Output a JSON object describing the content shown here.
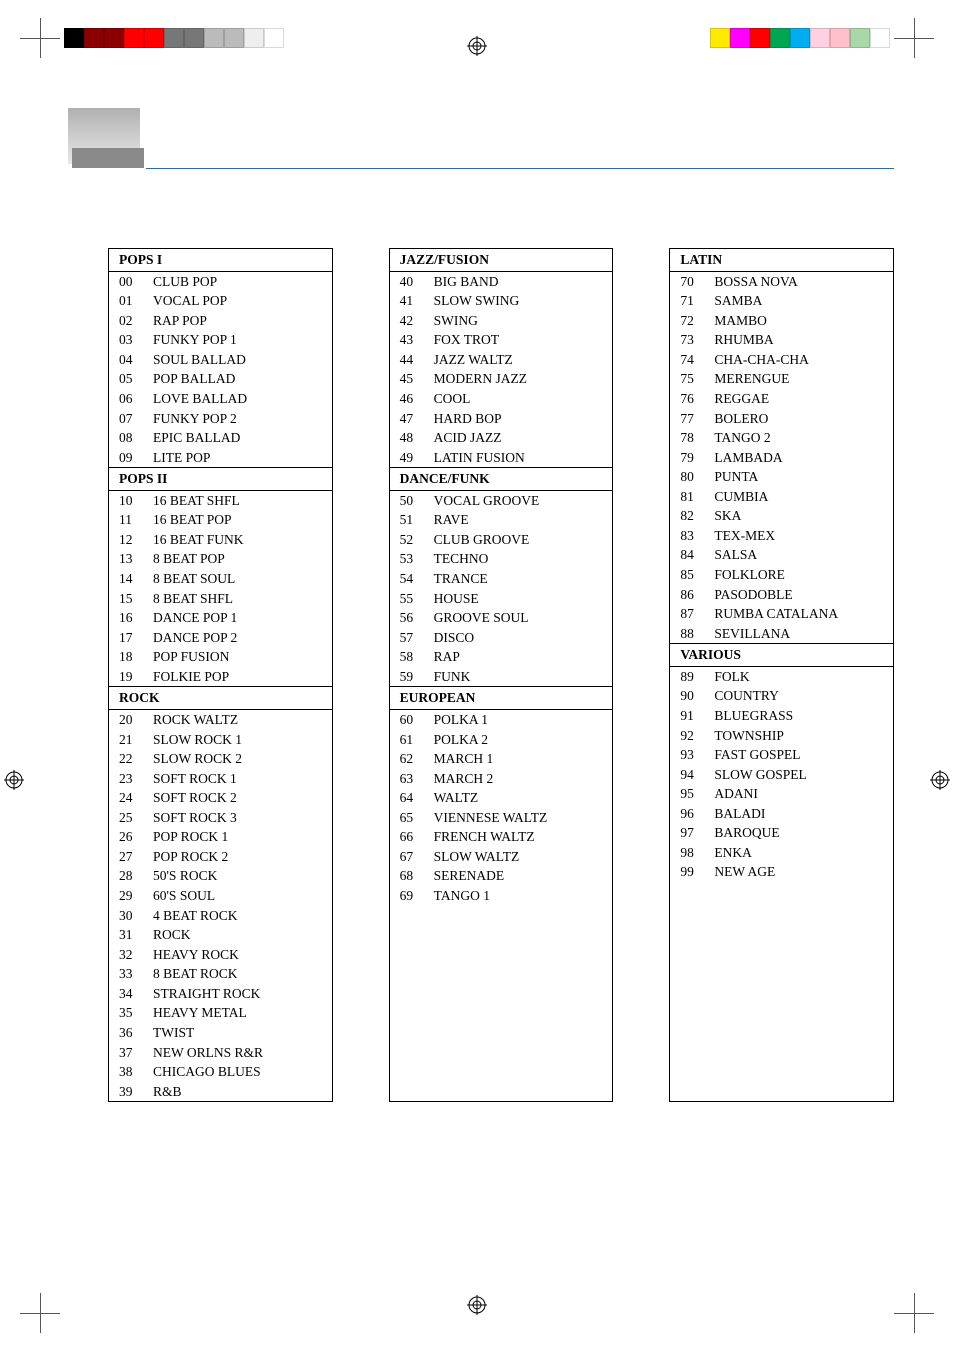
{
  "columns": [
    {
      "sections": [
        {
          "title": "POPS  I",
          "items": [
            {
              "n": "00",
              "t": "CLUB POP"
            },
            {
              "n": "01",
              "t": "VOCAL POP"
            },
            {
              "n": "02",
              "t": "RAP POP"
            },
            {
              "n": "03",
              "t": "FUNKY POP 1"
            },
            {
              "n": "04",
              "t": "SOUL BALLAD"
            },
            {
              "n": "05",
              "t": "POP BALLAD"
            },
            {
              "n": "06",
              "t": "LOVE BALLAD"
            },
            {
              "n": "07",
              "t": "FUNKY POP 2"
            },
            {
              "n": "08",
              "t": "EPIC BALLAD"
            },
            {
              "n": "09",
              "t": "LITE POP"
            }
          ]
        },
        {
          "title": "POPS  II",
          "items": [
            {
              "n": "10",
              "t": "16 BEAT SHFL"
            },
            {
              "n": "11",
              "t": "16 BEAT POP"
            },
            {
              "n": "12",
              "t": "16 BEAT FUNK"
            },
            {
              "n": "13",
              "t": "8 BEAT POP"
            },
            {
              "n": "14",
              "t": "8 BEAT SOUL"
            },
            {
              "n": "15",
              "t": "8 BEAT SHFL"
            },
            {
              "n": "16",
              "t": "DANCE POP 1"
            },
            {
              "n": "17",
              "t": "DANCE POP 2"
            },
            {
              "n": "18",
              "t": "POP FUSION"
            },
            {
              "n": "19",
              "t": "FOLKIE POP"
            }
          ]
        },
        {
          "title": "ROCK",
          "items": [
            {
              "n": "20",
              "t": "ROCK WALTZ"
            },
            {
              "n": "21",
              "t": "SLOW ROCK 1"
            },
            {
              "n": "22",
              "t": "SLOW ROCK 2"
            },
            {
              "n": "23",
              "t": "SOFT ROCK 1"
            },
            {
              "n": "24",
              "t": "SOFT ROCK 2"
            },
            {
              "n": "25",
              "t": "SOFT ROCK 3"
            },
            {
              "n": "26",
              "t": "POP ROCK 1"
            },
            {
              "n": "27",
              "t": "POP ROCK 2"
            },
            {
              "n": "28",
              "t": "50'S ROCK"
            },
            {
              "n": "29",
              "t": "60'S SOUL"
            },
            {
              "n": "30",
              "t": "4 BEAT ROCK"
            },
            {
              "n": "31",
              "t": "ROCK"
            },
            {
              "n": "32",
              "t": "HEAVY ROCK"
            },
            {
              "n": "33",
              "t": "8 BEAT ROCK"
            },
            {
              "n": "34",
              "t": "STRAIGHT ROCK"
            },
            {
              "n": "35",
              "t": "HEAVY METAL"
            },
            {
              "n": "36",
              "t": "TWIST"
            },
            {
              "n": "37",
              "t": "NEW ORLNS R&R"
            },
            {
              "n": "38",
              "t": "CHICAGO BLUES"
            },
            {
              "n": "39",
              "t": "R&B"
            }
          ]
        }
      ]
    },
    {
      "sections": [
        {
          "title": "JAZZ/FUSION",
          "items": [
            {
              "n": "40",
              "t": "BIG BAND"
            },
            {
              "n": "41",
              "t": "SLOW SWING"
            },
            {
              "n": "42",
              "t": "SWING"
            },
            {
              "n": "43",
              "t": "FOX TROT"
            },
            {
              "n": "44",
              "t": "JAZZ WALTZ"
            },
            {
              "n": "45",
              "t": "MODERN JAZZ"
            },
            {
              "n": "46",
              "t": "COOL"
            },
            {
              "n": "47",
              "t": "HARD BOP"
            },
            {
              "n": "48",
              "t": "ACID JAZZ"
            },
            {
              "n": "49",
              "t": "LATIN FUSION"
            }
          ]
        },
        {
          "title": "DANCE/FUNK",
          "items": [
            {
              "n": "50",
              "t": "VOCAL GROOVE"
            },
            {
              "n": "51",
              "t": "RAVE"
            },
            {
              "n": "52",
              "t": "CLUB GROOVE"
            },
            {
              "n": "53",
              "t": "TECHNO"
            },
            {
              "n": "54",
              "t": "TRANCE"
            },
            {
              "n": "55",
              "t": "HOUSE"
            },
            {
              "n": "56",
              "t": "GROOVE SOUL"
            },
            {
              "n": "57",
              "t": "DISCO"
            },
            {
              "n": "58",
              "t": "RAP"
            },
            {
              "n": "59",
              "t": "FUNK"
            }
          ]
        },
        {
          "title": "EUROPEAN",
          "items": [
            {
              "n": "60",
              "t": "POLKA 1"
            },
            {
              "n": "61",
              "t": "POLKA 2"
            },
            {
              "n": "62",
              "t": "MARCH 1"
            },
            {
              "n": "63",
              "t": "MARCH 2"
            },
            {
              "n": "64",
              "t": "WALTZ"
            },
            {
              "n": "65",
              "t": "VIENNESE WALTZ"
            },
            {
              "n": "66",
              "t": "FRENCH WALTZ"
            },
            {
              "n": "67",
              "t": "SLOW WALTZ"
            },
            {
              "n": "68",
              "t": "SERENADE"
            },
            {
              "n": "69",
              "t": "TANGO 1"
            }
          ]
        }
      ]
    },
    {
      "sections": [
        {
          "title": "LATIN",
          "items": [
            {
              "n": "70",
              "t": "BOSSA NOVA"
            },
            {
              "n": "71",
              "t": "SAMBA"
            },
            {
              "n": "72",
              "t": "MAMBO"
            },
            {
              "n": "73",
              "t": "RHUMBA"
            },
            {
              "n": "74",
              "t": "CHA-CHA-CHA"
            },
            {
              "n": "75",
              "t": "MERENGUE"
            },
            {
              "n": "76",
              "t": "REGGAE"
            },
            {
              "n": "77",
              "t": "BOLERO"
            },
            {
              "n": "78",
              "t": "TANGO 2"
            },
            {
              "n": "79",
              "t": "LAMBADA"
            },
            {
              "n": "80",
              "t": "PUNTA"
            },
            {
              "n": "81",
              "t": "CUMBIA"
            },
            {
              "n": "82",
              "t": "SKA"
            },
            {
              "n": "83",
              "t": "TEX-MEX"
            },
            {
              "n": "84",
              "t": "SALSA"
            },
            {
              "n": "85",
              "t": "FOLKLORE"
            },
            {
              "n": "86",
              "t": "PASODOBLE"
            },
            {
              "n": "87",
              "t": "RUMBA CATALANA"
            },
            {
              "n": "88",
              "t": "SEVILLANA"
            }
          ]
        },
        {
          "title": "VARIOUS",
          "items": [
            {
              "n": "89",
              "t": "FOLK"
            },
            {
              "n": "90",
              "t": "COUNTRY"
            },
            {
              "n": "91",
              "t": "BLUEGRASS"
            },
            {
              "n": "92",
              "t": "TOWNSHIP"
            },
            {
              "n": "93",
              "t": "FAST GOSPEL"
            },
            {
              "n": "94",
              "t": "SLOW GOSPEL"
            },
            {
              "n": "95",
              "t": "ADANI"
            },
            {
              "n": "96",
              "t": "BALADI"
            },
            {
              "n": "97",
              "t": "BAROQUE"
            },
            {
              "n": "98",
              "t": "ENKA"
            },
            {
              "n": "99",
              "t": "NEW AGE"
            }
          ]
        }
      ]
    }
  ],
  "colorbar_left": [
    "#000",
    "#8b0000",
    "#8b0000",
    "#ff0000",
    "#ff0000",
    "#777",
    "#777",
    "#bbb",
    "#bbb",
    "#eee",
    "#fff"
  ],
  "colorbar_right": [
    "#ffea00",
    "#ff00ff",
    "#ff0000",
    "#00a651",
    "#00aeef",
    "#ffcfe2",
    "#ffc0cb",
    "#a8d8a8",
    "#fff"
  ]
}
